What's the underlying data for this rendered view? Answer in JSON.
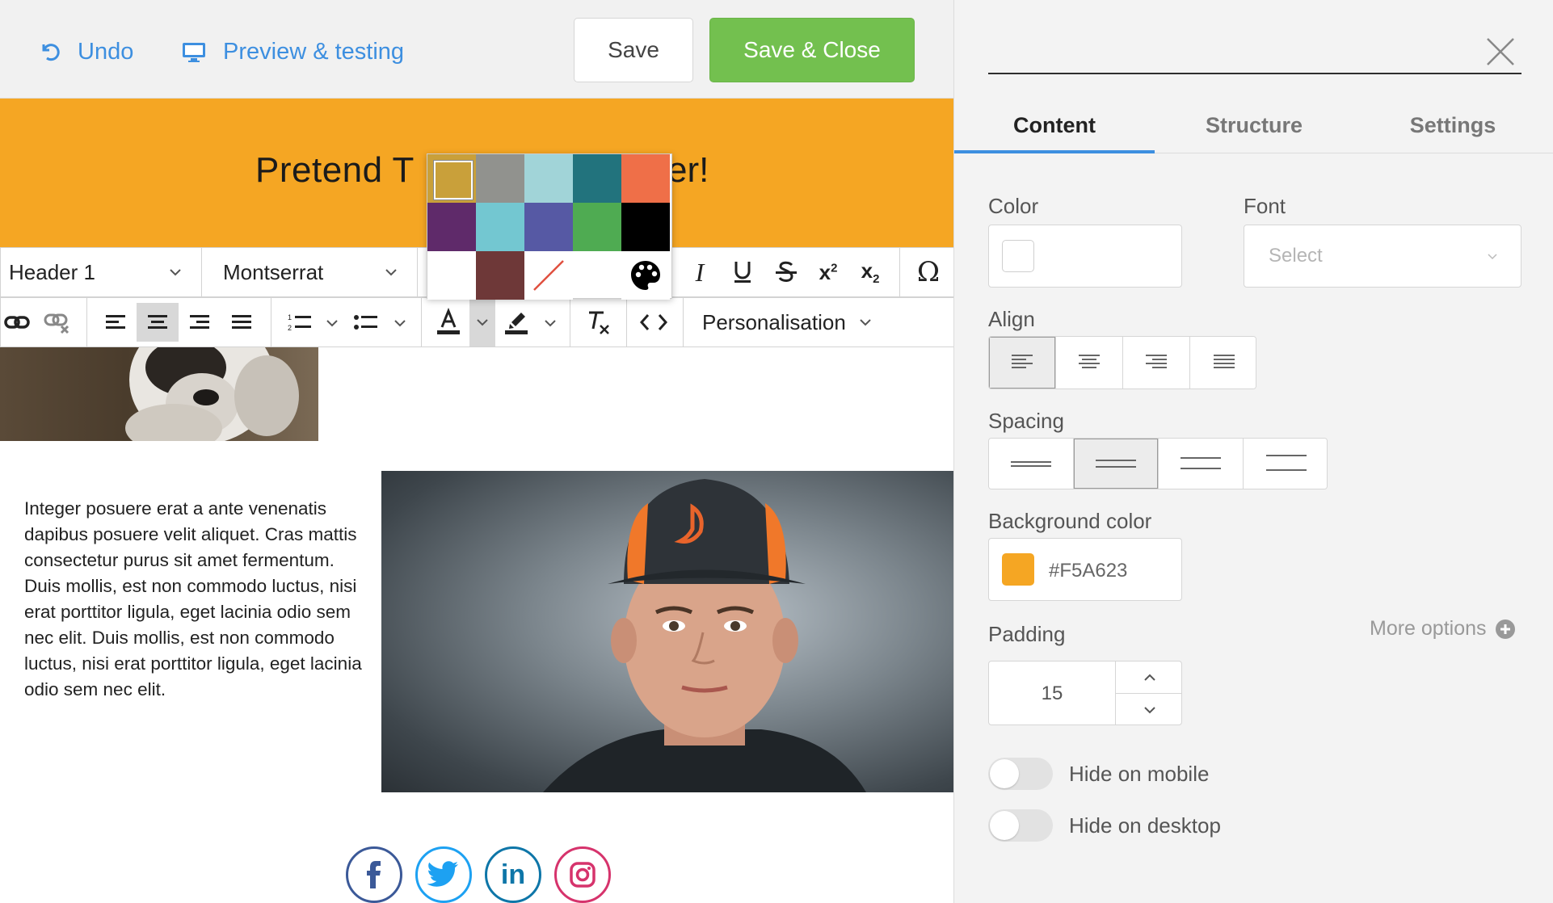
{
  "topbar": {
    "undo_label": "Undo",
    "preview_label": "Preview & testing",
    "save_label": "Save",
    "save_close_label": "Save & Close"
  },
  "email": {
    "header_text_start": "Pretend T",
    "header_text_end": "er!",
    "body_text": "Integer posuere erat a ante venenatis dapibus posuere velit aliquet. Cras mattis consectetur purus sit amet fermentum. Duis mollis, est non commodo luctus, nisi erat porttitor ligula, eget lacinia odio sem nec elit. Duis mollis, est non commodo luctus, nisi erat porttitor ligula, eget lacinia odio sem nec elit.",
    "social": [
      "facebook-icon",
      "twitter-icon",
      "linkedin-icon",
      "instagram-icon"
    ]
  },
  "toolbar": {
    "format_value": "Header 1",
    "font_value": "Montserrat",
    "personalisation_label": "Personalisation"
  },
  "swatches": {
    "colors": [
      "#c9a03a",
      "#91928e",
      "#a1d4d8",
      "#22737d",
      "#ef6f48",
      "#5f2a6a",
      "#73c7d1",
      "#5659a4",
      "#4fab52",
      "#000000",
      "#ffffff",
      "#6e3838"
    ],
    "selected": "#c9a03a"
  },
  "panel": {
    "tabs": [
      {
        "label": "Content",
        "active": true
      },
      {
        "label": "Structure",
        "active": false
      },
      {
        "label": "Settings",
        "active": false
      }
    ],
    "color_label": "Color",
    "font_label": "Font",
    "font_placeholder": "Select",
    "align_label": "Align",
    "spacing_label": "Spacing",
    "background_label": "Background color",
    "background_value": "#F5A623",
    "background_swatch": "#f5a623",
    "padding_label": "Padding",
    "padding_value": "15",
    "more_options_label": "More options",
    "hide_mobile_label": "Hide on mobile",
    "hide_desktop_label": "Hide on desktop"
  }
}
